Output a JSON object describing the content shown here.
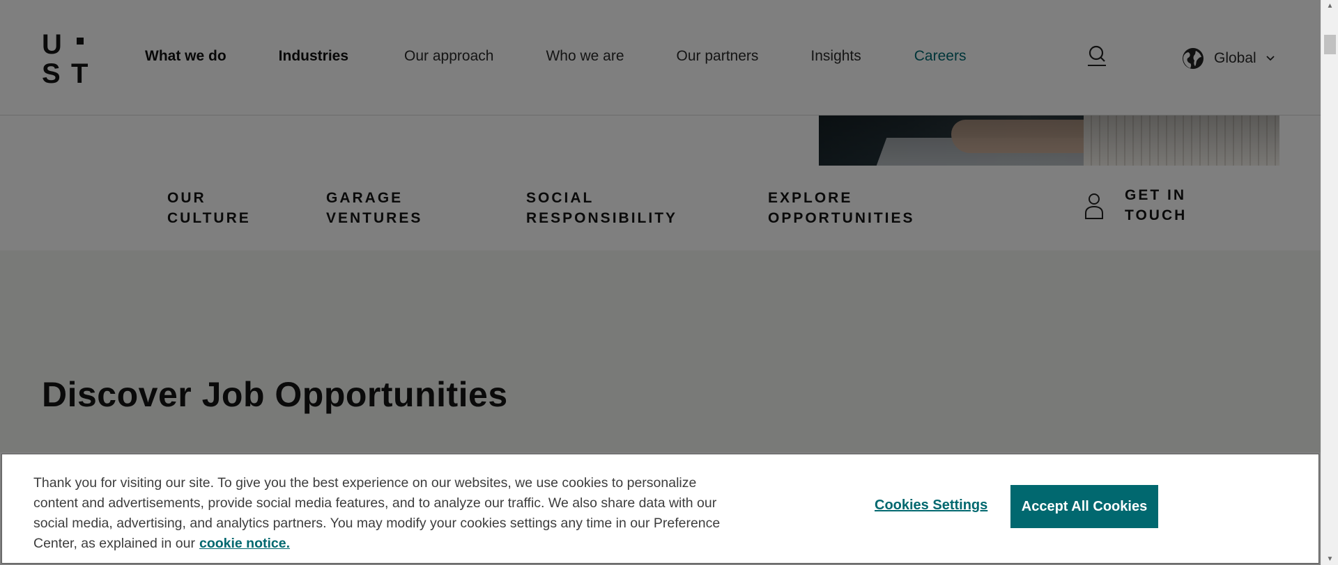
{
  "header": {
    "logo": {
      "letters": [
        "U",
        "S",
        "T"
      ]
    },
    "nav": [
      {
        "label": "What we do"
      },
      {
        "label": "Industries"
      },
      {
        "label": "Our approach"
      },
      {
        "label": "Who we are"
      },
      {
        "label": "Our partners"
      },
      {
        "label": "Insights"
      },
      {
        "label": "Careers"
      }
    ],
    "search_icon": "search-icon",
    "region": {
      "icon": "globe-icon",
      "label": "Global",
      "chevron": "chevron-down-icon"
    }
  },
  "subnav": {
    "items": [
      {
        "line1": "OUR",
        "line2": "CULTURE"
      },
      {
        "line1": "GARAGE",
        "line2": "VENTURES"
      },
      {
        "line1": "SOCIAL",
        "line2": "RESPONSIBILITY"
      },
      {
        "line1": "EXPLORE",
        "line2": "OPPORTUNITIES"
      }
    ],
    "contact": {
      "icon": "person-icon",
      "line1": "GET IN",
      "line2": "TOUCH"
    }
  },
  "main": {
    "heading": "Discover Job Opportunities"
  },
  "cookie_banner": {
    "text": "Thank you for visiting our site. To give you the best experience on our websites, we use cookies to personalize content and advertisements, provide social media features, and to analyze our traffic. We also share data with our social media, advertising, and analytics partners. You may modify your cookies settings any time in our Preference Center, as explained in our",
    "link": "cookie notice.",
    "settings_label": "Cookies Settings",
    "accept_label": "Accept All Cookies"
  },
  "colors": {
    "accent": "#01686f",
    "overlay": "rgba(0,0,0,0.5)",
    "text": "#141414"
  }
}
